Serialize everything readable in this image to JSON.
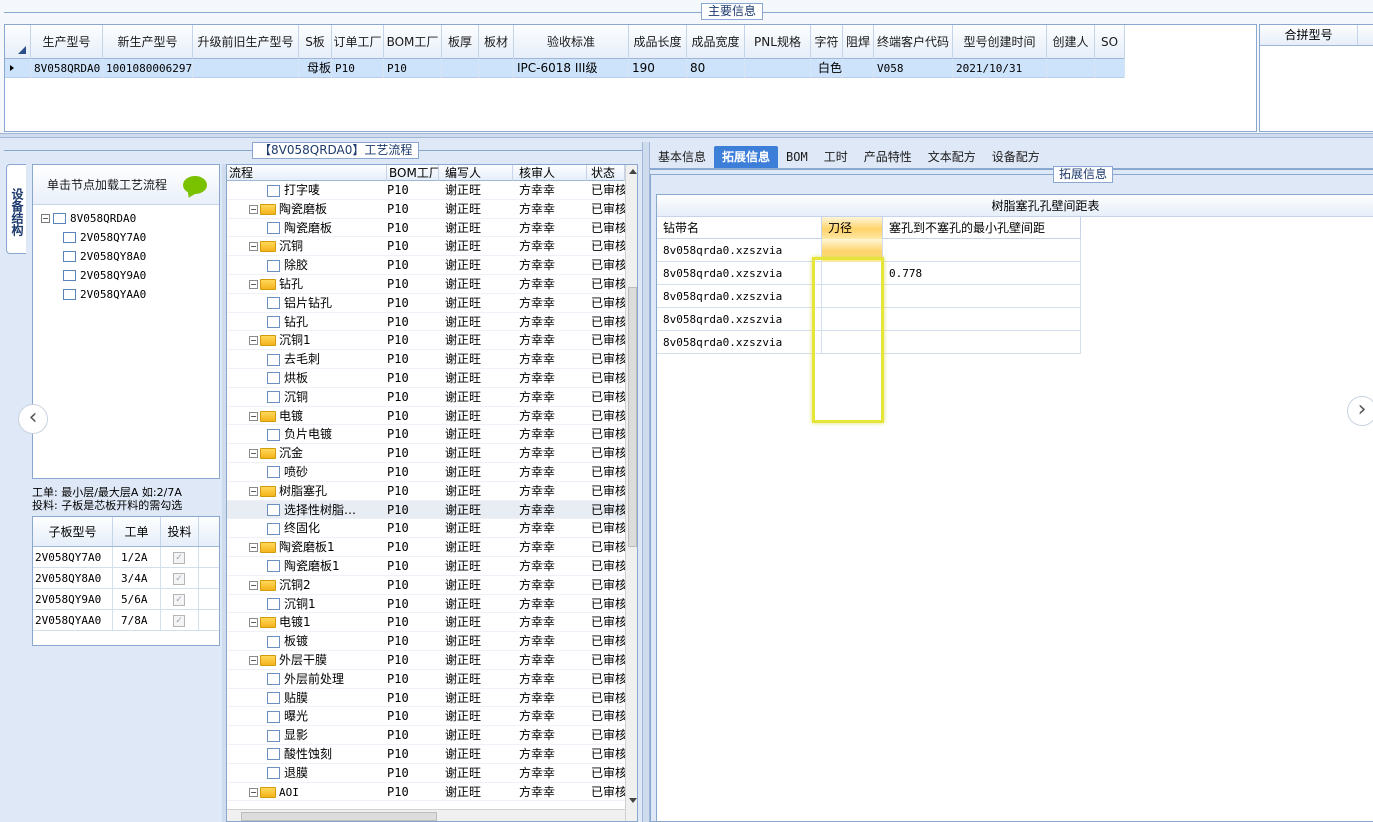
{
  "main_info": {
    "section_title": "主要信息",
    "columns": [
      "生产型号",
      "新生产型号",
      "升级前旧生产型号",
      "S板",
      "订单工厂",
      "BOM工厂",
      "板厚",
      "板材",
      "验收标准",
      "成品长度",
      "成品宽度",
      "PNL规格",
      "字符",
      "阻焊",
      "终端客户代码",
      "型号创建时间",
      "创建人",
      "SO"
    ],
    "row": [
      "8V058QRDA0",
      "10010800062971",
      "",
      "母板",
      "P10",
      "P10",
      "",
      "",
      "IPC-6018 III级",
      "190",
      "80",
      "",
      "白色",
      "",
      "V058",
      "2021/10/31",
      "",
      ""
    ],
    "merge_header": "合拼型号"
  },
  "left_panel": {
    "flow_title": "【8V058QRDA0】工艺流程",
    "side_tab_label": "设备结构",
    "load_flow_label": "单击节点加载工艺流程",
    "tree": {
      "root": "8V058QRDA0",
      "children": [
        "2V058QY7A0",
        "2V058QY8A0",
        "2V058QY9A0",
        "2V058QYAA0"
      ]
    },
    "note_line1": "工单: 最小层/最大层A 如:2/7A",
    "note_line2": "投料: 子板是芯板开料的需勾选",
    "sub_grid": {
      "headers": [
        "子板型号",
        "工单",
        "投料"
      ],
      "rows": [
        {
          "model": "2V058QY7A0",
          "order": "1/2A",
          "checked": "✓"
        },
        {
          "model": "2V058QY8A0",
          "order": "3/4A",
          "checked": "✓"
        },
        {
          "model": "2V058QY9A0",
          "order": "5/6A",
          "checked": "✓"
        },
        {
          "model": "2V058QYAA0",
          "order": "7/8A",
          "checked": "✓"
        }
      ]
    }
  },
  "flow_grid": {
    "headers": [
      "流程",
      "BOM工厂",
      "编写人",
      "核审人",
      "状态"
    ],
    "rows": [
      {
        "name": "打字唛",
        "level": 2,
        "bom": "P10",
        "writer": "谢正旺",
        "reviewer": "方幸幸",
        "status": "已审核"
      },
      {
        "name": "陶瓷磨板",
        "level": 1,
        "bom": "P10",
        "writer": "谢正旺",
        "reviewer": "方幸幸",
        "status": "已审核"
      },
      {
        "name": "陶瓷磨板",
        "level": 2,
        "bom": "P10",
        "writer": "谢正旺",
        "reviewer": "方幸幸",
        "status": "已审核"
      },
      {
        "name": "沉铜",
        "level": 1,
        "bom": "P10",
        "writer": "谢正旺",
        "reviewer": "方幸幸",
        "status": "已审核"
      },
      {
        "name": "除胶",
        "level": 2,
        "bom": "P10",
        "writer": "谢正旺",
        "reviewer": "方幸幸",
        "status": "已审核"
      },
      {
        "name": "钻孔",
        "level": 1,
        "bom": "P10",
        "writer": "谢正旺",
        "reviewer": "方幸幸",
        "status": "已审核"
      },
      {
        "name": "铝片钻孔",
        "level": 2,
        "bom": "P10",
        "writer": "谢正旺",
        "reviewer": "方幸幸",
        "status": "已审核"
      },
      {
        "name": "钻孔",
        "level": 2,
        "bom": "P10",
        "writer": "谢正旺",
        "reviewer": "方幸幸",
        "status": "已审核"
      },
      {
        "name": "沉铜1",
        "level": 1,
        "bom": "P10",
        "writer": "谢正旺",
        "reviewer": "方幸幸",
        "status": "已审核"
      },
      {
        "name": "去毛刺",
        "level": 2,
        "bom": "P10",
        "writer": "谢正旺",
        "reviewer": "方幸幸",
        "status": "已审核"
      },
      {
        "name": "烘板",
        "level": 2,
        "bom": "P10",
        "writer": "谢正旺",
        "reviewer": "方幸幸",
        "status": "已审核"
      },
      {
        "name": "沉铜",
        "level": 2,
        "bom": "P10",
        "writer": "谢正旺",
        "reviewer": "方幸幸",
        "status": "已审核"
      },
      {
        "name": "电镀",
        "level": 1,
        "bom": "P10",
        "writer": "谢正旺",
        "reviewer": "方幸幸",
        "status": "已审核"
      },
      {
        "name": "负片电镀",
        "level": 2,
        "bom": "P10",
        "writer": "谢正旺",
        "reviewer": "方幸幸",
        "status": "已审核"
      },
      {
        "name": "沉金",
        "level": 1,
        "bom": "P10",
        "writer": "谢正旺",
        "reviewer": "方幸幸",
        "status": "已审核"
      },
      {
        "name": "喷砂",
        "level": 2,
        "bom": "P10",
        "writer": "谢正旺",
        "reviewer": "方幸幸",
        "status": "已审核"
      },
      {
        "name": "树脂塞孔",
        "level": 1,
        "bom": "P10",
        "writer": "谢正旺",
        "reviewer": "方幸幸",
        "status": "已审核"
      },
      {
        "name": "选择性树脂…",
        "level": 2,
        "bom": "P10",
        "writer": "谢正旺",
        "reviewer": "方幸幸",
        "status": "已审核",
        "selected": true
      },
      {
        "name": "终固化",
        "level": 2,
        "bom": "P10",
        "writer": "谢正旺",
        "reviewer": "方幸幸",
        "status": "已审核"
      },
      {
        "name": "陶瓷磨板1",
        "level": 1,
        "bom": "P10",
        "writer": "谢正旺",
        "reviewer": "方幸幸",
        "status": "已审核"
      },
      {
        "name": "陶瓷磨板1",
        "level": 2,
        "bom": "P10",
        "writer": "谢正旺",
        "reviewer": "方幸幸",
        "status": "已审核"
      },
      {
        "name": "沉铜2",
        "level": 1,
        "bom": "P10",
        "writer": "谢正旺",
        "reviewer": "方幸幸",
        "status": "已审核"
      },
      {
        "name": "沉铜1",
        "level": 2,
        "bom": "P10",
        "writer": "谢正旺",
        "reviewer": "方幸幸",
        "status": "已审核"
      },
      {
        "name": "电镀1",
        "level": 1,
        "bom": "P10",
        "writer": "谢正旺",
        "reviewer": "方幸幸",
        "status": "已审核"
      },
      {
        "name": "板镀",
        "level": 2,
        "bom": "P10",
        "writer": "谢正旺",
        "reviewer": "方幸幸",
        "status": "已审核"
      },
      {
        "name": "外层干膜",
        "level": 1,
        "bom": "P10",
        "writer": "谢正旺",
        "reviewer": "方幸幸",
        "status": "已审核"
      },
      {
        "name": "外层前处理",
        "level": 2,
        "bom": "P10",
        "writer": "谢正旺",
        "reviewer": "方幸幸",
        "status": "已审核"
      },
      {
        "name": "贴膜",
        "level": 2,
        "bom": "P10",
        "writer": "谢正旺",
        "reviewer": "方幸幸",
        "status": "已审核"
      },
      {
        "name": "曝光",
        "level": 2,
        "bom": "P10",
        "writer": "谢正旺",
        "reviewer": "方幸幸",
        "status": "已审核"
      },
      {
        "name": "显影",
        "level": 2,
        "bom": "P10",
        "writer": "谢正旺",
        "reviewer": "方幸幸",
        "status": "已审核"
      },
      {
        "name": "酸性蚀刻",
        "level": 2,
        "bom": "P10",
        "writer": "谢正旺",
        "reviewer": "方幸幸",
        "status": "已审核"
      },
      {
        "name": "退膜",
        "level": 2,
        "bom": "P10",
        "writer": "谢正旺",
        "reviewer": "方幸幸",
        "status": "已审核"
      },
      {
        "name": "AOI",
        "level": 1,
        "bom": "P10",
        "writer": "谢正旺",
        "reviewer": "方幸幸",
        "status": "已审核"
      }
    ]
  },
  "right_panel": {
    "tabs": [
      "基本信息",
      "拓展信息",
      "BOM",
      "工时",
      "产品特性",
      "文本配方",
      "设备配方"
    ],
    "active_tab": "拓展信息",
    "ext_title": "拓展信息",
    "group_header": "树脂塞孔孔壁间距表",
    "columns": [
      "钻带名",
      "刀径",
      "塞孔到不塞孔的最小孔壁间距"
    ],
    "rows": [
      {
        "drill": "8v058qrda0.xzszvia",
        "knife": "",
        "min": ""
      },
      {
        "drill": "8v058qrda0.xzszvia",
        "knife": "",
        "min": "0.778"
      },
      {
        "drill": "8v058qrda0.xzszvia",
        "knife": "",
        "min": ""
      },
      {
        "drill": "8v058qrda0.xzszvia",
        "knife": "",
        "min": ""
      },
      {
        "drill": "8v058qrda0.xzszvia",
        "knife": "",
        "min": ""
      }
    ]
  },
  "icons": {
    "prev": "‹",
    "next": "›",
    "collapse": "−"
  },
  "colors": {
    "accent": "#3d7ed9",
    "highlight": "#e5e53a",
    "selected_row": "#cde3fb"
  }
}
